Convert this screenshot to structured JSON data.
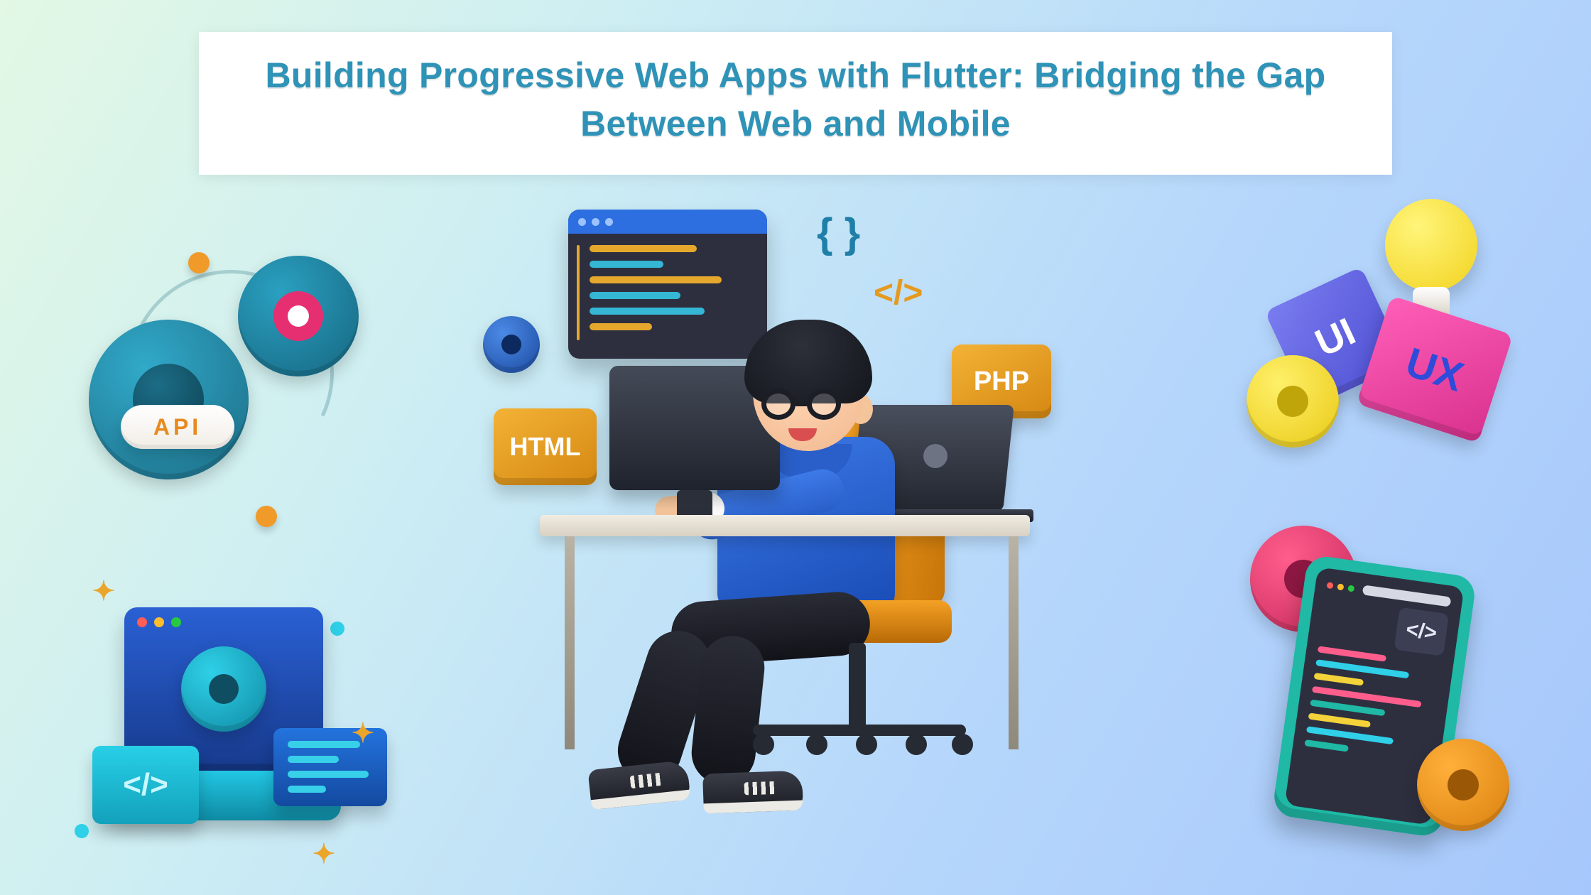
{
  "title": "Building Progressive Web Apps with Flutter: Bridging the Gap Between Web and Mobile",
  "badges": {
    "api": "API",
    "html": "HTML",
    "php": "PHP",
    "ui": "UI",
    "ux": "UX",
    "code_tag": "</>",
    "braces": "{ }",
    "tag_glyph": "</>"
  },
  "colors": {
    "title": "#2f93b7",
    "teal": "#1c8aa6",
    "orange": "#e59a1e",
    "blue": "#2d6fe0",
    "pink": "#e6348f",
    "purple": "#5b5de0",
    "yellow": "#efd21e",
    "mint": "#1fb9a6"
  }
}
